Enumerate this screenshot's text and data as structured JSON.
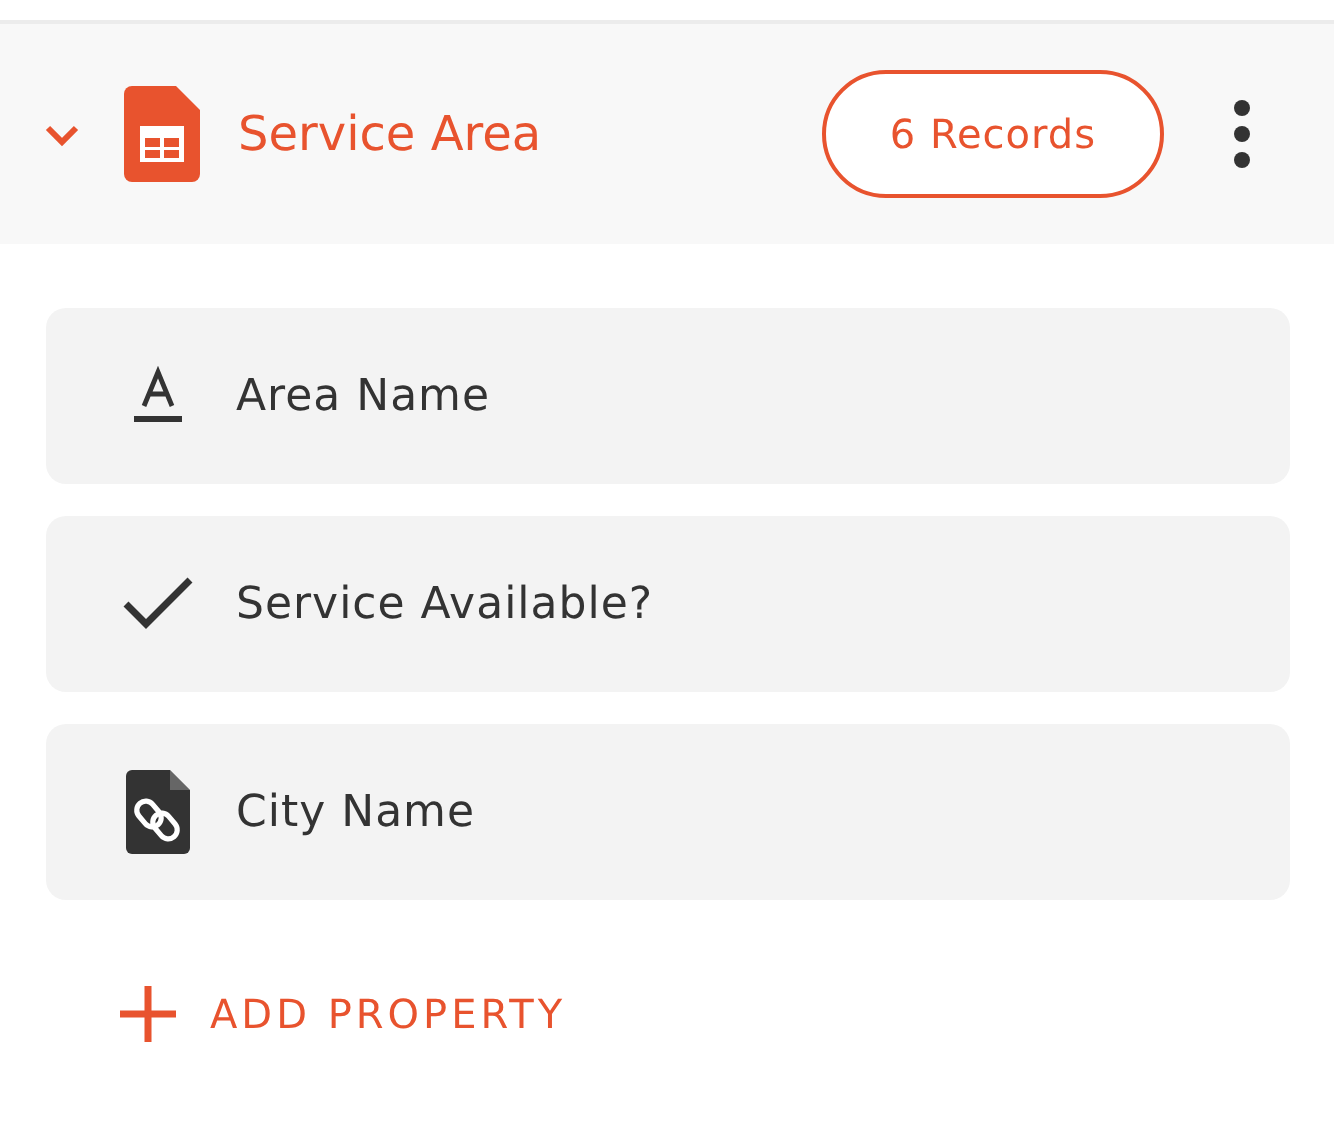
{
  "table": {
    "title": "Service Area",
    "records": "6 Records",
    "expanded": true
  },
  "properties": [
    {
      "label": "Area Name",
      "kind": "text"
    },
    {
      "label": "Service Available?",
      "kind": "boolean"
    },
    {
      "label": "City Name",
      "kind": "link"
    }
  ],
  "add_button": {
    "label": "ADD PROPERTY"
  }
}
